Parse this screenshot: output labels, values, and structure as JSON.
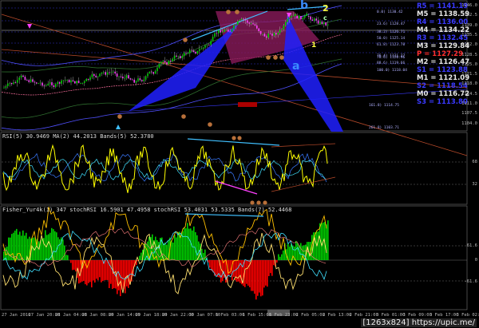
{
  "subwindows": {
    "rsi_header": "RSI(5) 30.9469   MA(2) 44.2013   Bands(5) 52.3780",
    "fisher_header": "Fisher_Yur4k(1) 347  stochRSI 16.5901 47.4958  stochRSI 53.4031 53.5335  Bands(7) 52.4468"
  },
  "pivot_levels": [
    {
      "label": "R5 = 1141.19",
      "color": "#3a3aff"
    },
    {
      "label": "M5 = 1138.59",
      "color": "#e8e8e8"
    },
    {
      "label": "R4 = 1136.00",
      "color": "#3a3aff"
    },
    {
      "label": "M4 = 1134.22",
      "color": "#e8e8e8"
    },
    {
      "label": "R3 = 1132.45",
      "color": "#3a3aff"
    },
    {
      "label": "M3 = 1129.84",
      "color": "#e8e8e8"
    },
    {
      "label": "P = 1127.29",
      "color": "#ff3030"
    },
    {
      "label": "M2 = 1126.47",
      "color": "#e8e8e8"
    },
    {
      "label": "S1 = 1123.88",
      "color": "#3a3aff"
    },
    {
      "label": "M1 = 1121.09",
      "color": "#e8e8e8"
    },
    {
      "label": "S2 = 1118.54",
      "color": "#3a3aff"
    },
    {
      "label": "M0 = 1116.72",
      "color": "#e8e8e8"
    },
    {
      "label": "S3 = 1113.80",
      "color": "#3a3aff"
    }
  ],
  "price_ticks": [
    "1146.0",
    "1142.5",
    "1139.0",
    "1135.5",
    "1132.0",
    "1128.5",
    "1125.0",
    "1121.5",
    "1118.0",
    "1114.5",
    "1111.0",
    "1107.5",
    "1104.0"
  ],
  "rsi_ticks": [
    "68",
    "32"
  ],
  "fisher_ticks": [
    "61.6",
    "0",
    "-61.6"
  ],
  "time_ticks": [
    "27 Jan 2016",
    "27 Jan 20:00",
    "28 Jan 04:00",
    "28 Jan 08:00",
    "29 Jan 14:00",
    "29 Jan 18:00",
    "29 Jan 22:00",
    "30 Jan 07:00",
    "1 Feb 03:00",
    "1 Feb 15:00",
    "1 Feb 23:00",
    "2 Feb 05:00",
    "2 Feb 13:00",
    "2 Feb 21:00",
    "3 Feb 01:00",
    "3 Feb 09:00",
    "3 Feb 17:00",
    "3 Feb 02:00"
  ],
  "fib_labels": [
    "0.0) 1130.42",
    "23.6) 1128.47",
    "38.2) 1126.71",
    "50.0) 1125.14",
    "61.8) 1123.78",
    "76.4) 1121.27",
    "78.6) 1120.96",
    "88.6) 1119.66",
    "100.0) 1118.04",
    "161.8) 1114.75",
    "261.8) 1103.71"
  ],
  "wave_labels": {
    "b": "b",
    "two": "2",
    "a": "a",
    "one": "1",
    "c": "c"
  },
  "watermark": "[1263x824] https://upic.me/",
  "colors": {
    "buy": "#00d000",
    "sell": "#ff0000",
    "ma": "#ffff00",
    "fib": "#0000ff",
    "pivot": "#ff3030",
    "band": "#3a3aff"
  },
  "chart_data": [
    {
      "type": "candlestick",
      "title": "",
      "ylim": [
        1104.0,
        1146.0
      ],
      "note": "Candles with wave count a-b-c, Fibonacci retracement box and pivot levels"
    },
    {
      "type": "line",
      "title": "",
      "series": [
        {
          "name": "RSI(5)",
          "last": 30.9469
        },
        {
          "name": "MA(2)",
          "last": 44.2013
        },
        {
          "name": "Bands(5)",
          "last": 52.378
        }
      ],
      "ylim": [
        0,
        100
      ],
      "levels": [
        68,
        32
      ]
    },
    {
      "type": "bar",
      "title": "",
      "series": [
        {
          "name": "Fisher_Yur4k",
          "last": 347
        },
        {
          "name": "stochRSI",
          "last": 16.5901
        }
      ],
      "levels": [
        61.6,
        0,
        -61.6
      ]
    }
  ]
}
